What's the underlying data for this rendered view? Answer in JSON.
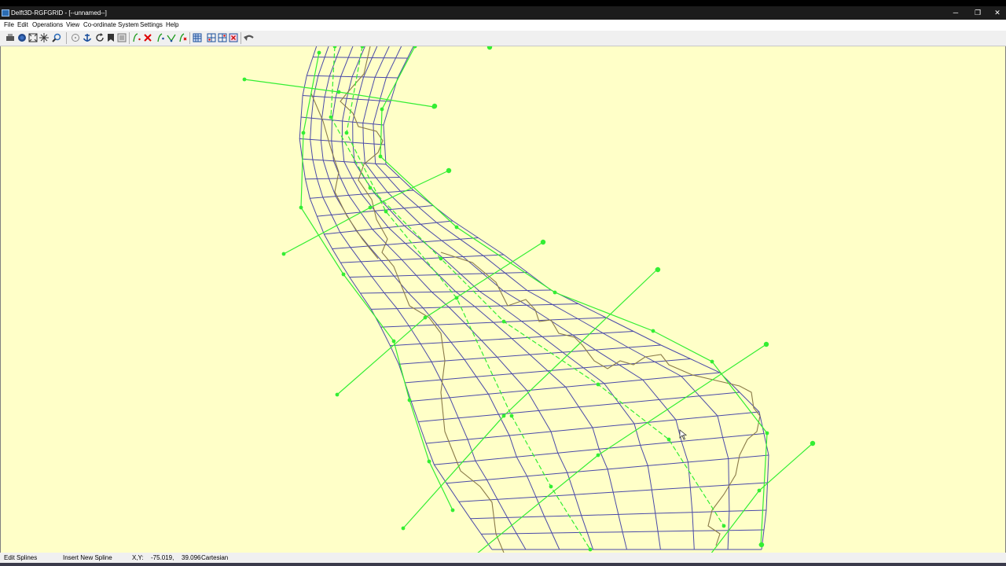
{
  "window": {
    "title": "Delft3D-RGFGRID - [--unnamed--]",
    "minimize_glyph": "─",
    "restore_glyph": "❐",
    "close_glyph": "✕"
  },
  "menu": [
    "File",
    "Edit",
    "Operations",
    "View",
    "Co-ordinate System",
    "Settings",
    "Help"
  ],
  "toolbar_icons": [
    "print-icon",
    "globe-icon",
    "zoom-extent-icon",
    "pan-icon",
    "zoom-icon",
    "landboundary-icon",
    "anchor-icon",
    "refresh-icon",
    "bookmark-icon",
    "list-icon",
    "new-spline-icon",
    "delete-spline-icon",
    "spline-point-icon",
    "spline-move-icon",
    "spline-insert-icon",
    "grid-icon",
    "grid-refine-icon",
    "grid-select-icon",
    "grid-delete-icon",
    "undo-icon"
  ],
  "status": {
    "mode": "Edit Splines",
    "action": "Insert New Spline",
    "xy_label": "X,Y:",
    "x_value": "-75.019,",
    "y_value": "39.096",
    "coord_system": "Cartesian"
  },
  "colors": {
    "canvas_bg": "#ffffc8",
    "grid_lines": "#4a4aa8",
    "splines": "#33ee33",
    "land_boundary": "#8a7a48"
  }
}
